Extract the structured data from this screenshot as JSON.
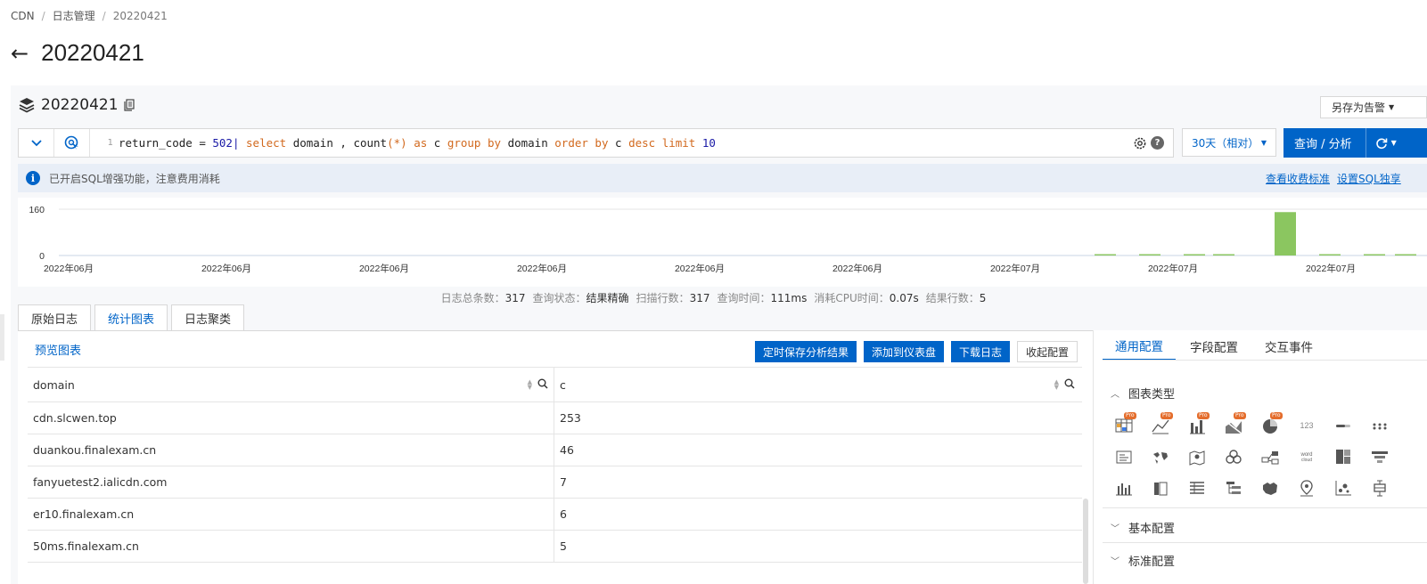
{
  "breadcrumb": {
    "items": [
      "CDN",
      "日志管理",
      "20220421"
    ],
    "sep": "/"
  },
  "page": {
    "back_icon": "←",
    "title": "20220421"
  },
  "logstore": {
    "name": "20220421",
    "save_alarm": "另存为告警"
  },
  "query": {
    "line_number": "1",
    "tokens": [
      {
        "t": "return_code",
        "c": "op"
      },
      {
        "t": " = ",
        "c": "op"
      },
      {
        "t": "502",
        "c": "num"
      },
      {
        "t": "| ",
        "c": "num"
      },
      {
        "t": "select",
        "c": "kw"
      },
      {
        "t": " domain , ",
        "c": "op"
      },
      {
        "t": "count",
        "c": "op"
      },
      {
        "t": "(*)",
        "c": "kw"
      },
      {
        "t": " ",
        "c": "op"
      },
      {
        "t": "as",
        "c": "kw"
      },
      {
        "t": " c ",
        "c": "op"
      },
      {
        "t": "group by",
        "c": "kw"
      },
      {
        "t": " domain ",
        "c": "op"
      },
      {
        "t": "order by",
        "c": "kw"
      },
      {
        "t": " c ",
        "c": "op"
      },
      {
        "t": "desc",
        "c": "kw"
      },
      {
        "t": " ",
        "c": "op"
      },
      {
        "t": "limit",
        "c": "kw"
      },
      {
        "t": " ",
        "c": "op"
      },
      {
        "t": "10",
        "c": "num"
      }
    ],
    "time_range": "30天（相对）",
    "search_label": "查询 / 分析"
  },
  "notice": {
    "text": "已开启SQL增强功能，注意费用消耗",
    "links": [
      "查看收费标准",
      "设置SQL独享"
    ]
  },
  "histogram": {
    "y_ticks": [
      "160",
      "0"
    ],
    "x_labels": [
      "2022年06月",
      "2022年06月",
      "2022年06月",
      "2022年06月",
      "2022年06月",
      "2022年06月",
      "2022年07月",
      "2022年07月",
      "2022年07月"
    ],
    "bar_color": "#8bc660",
    "ymax": 160,
    "bars": [
      {
        "slot": 0,
        "v": 3
      },
      {
        "slot": 1,
        "v": 4
      },
      {
        "slot": 2,
        "v": 4
      },
      {
        "slot": 3,
        "v": 2
      },
      {
        "slot": 5,
        "v": 150
      },
      {
        "slot": 6,
        "v": 2
      },
      {
        "slot": 7,
        "v": 3
      },
      {
        "slot": 8,
        "v": 2
      }
    ]
  },
  "stats": {
    "items": [
      {
        "k": "日志总条数：",
        "v": "317"
      },
      {
        "k": "查询状态：",
        "v": "结果精确"
      },
      {
        "k": "扫描行数：",
        "v": "317"
      },
      {
        "k": "查询时间：",
        "v": "111ms"
      },
      {
        "k": "消耗CPU时间：",
        "v": "0.07s"
      },
      {
        "k": "结果行数：",
        "v": "5"
      }
    ]
  },
  "tabs": [
    "原始日志",
    "统计图表",
    "日志聚类"
  ],
  "active_tab": 1,
  "preview_label": "预览图表",
  "actions": [
    "定时保存分析结果",
    "添加到仪表盘",
    "下载日志",
    "收起配置"
  ],
  "table": {
    "columns": [
      "domain",
      "c"
    ],
    "rows": [
      [
        "cdn.slcwen.top",
        "253"
      ],
      [
        "duankou.finalexam.cn",
        "46"
      ],
      [
        "fanyuetest2.ialicdn.com",
        "7"
      ],
      [
        "er10.finalexam.cn",
        "6"
      ],
      [
        "50ms.finalexam.cn",
        "5"
      ]
    ]
  },
  "config": {
    "tabs": [
      "通用配置",
      "字段配置",
      "交互事件"
    ],
    "sections": [
      "图表类型",
      "基本配置",
      "标准配置"
    ],
    "pro_label": "Pro",
    "icons": [
      "table-pro-icon",
      "line-pro-icon",
      "bar-pro-icon",
      "area-pro-icon",
      "pie-pro-icon",
      "number-icon",
      "progress-icon",
      "dots-icon",
      "text-card-icon",
      "world-map-icon",
      "map-pin-icon",
      "flow-icon",
      "topology-icon",
      "word-cloud-icon",
      "treemap-icon",
      "funnel-icon",
      "column-icon",
      "bar-icon",
      "table-icon",
      "tree-icon",
      "china-map-icon",
      "amap-icon",
      "scatter-icon",
      "boxplot-icon"
    ],
    "number_text": "123",
    "word_cloud_text": "word cloud"
  }
}
